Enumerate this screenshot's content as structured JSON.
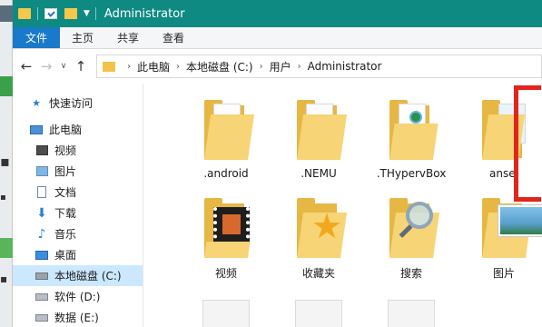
{
  "window": {
    "title": "Administrator"
  },
  "ribbon_tabs": [
    {
      "label": "文件"
    },
    {
      "label": "主页"
    },
    {
      "label": "共享"
    },
    {
      "label": "查看"
    }
  ],
  "address": {
    "crumbs": [
      {
        "label": "此电脑"
      },
      {
        "label": "本地磁盘 (C:)"
      },
      {
        "label": "用户"
      },
      {
        "label": "Administrator"
      }
    ]
  },
  "nav": {
    "items": [
      {
        "label": "快速访问",
        "icon": "star-icon"
      },
      {
        "label": "此电脑",
        "icon": "computer-icon"
      },
      {
        "label": "视频",
        "icon": "video-icon"
      },
      {
        "label": "图片",
        "icon": "picture-icon"
      },
      {
        "label": "文档",
        "icon": "document-icon"
      },
      {
        "label": "下载",
        "icon": "download-icon"
      },
      {
        "label": "音乐",
        "icon": "music-icon"
      },
      {
        "label": "桌面",
        "icon": "desktop-icon"
      },
      {
        "label": "本地磁盘 (C:)",
        "icon": "drive-icon",
        "selected": true
      },
      {
        "label": "软件 (D:)",
        "icon": "drive-icon"
      },
      {
        "label": "数据 (E:)",
        "icon": "drive-icon"
      }
    ]
  },
  "files": [
    {
      "name": ".android",
      "icon": "folder-icon"
    },
    {
      "name": ".NEMU",
      "icon": "folder-icon"
    },
    {
      "name": ".THypervBox",
      "icon": "folder-document-icon"
    },
    {
      "name": "ansel",
      "icon": "folder-image-icon"
    },
    {
      "name": "视频",
      "icon": "folder-video-icon"
    },
    {
      "name": "收藏夹",
      "icon": "folder-star-icon"
    },
    {
      "name": "搜索",
      "icon": "folder-search-icon"
    },
    {
      "name": "图片",
      "icon": "folder-picture-icon"
    }
  ],
  "colors": {
    "titlebar": "#0e8a83",
    "file_tab": "#1979ca",
    "selection": "#cce8ff",
    "folder": "#f7d475",
    "highlight_box": "#e3241b"
  }
}
